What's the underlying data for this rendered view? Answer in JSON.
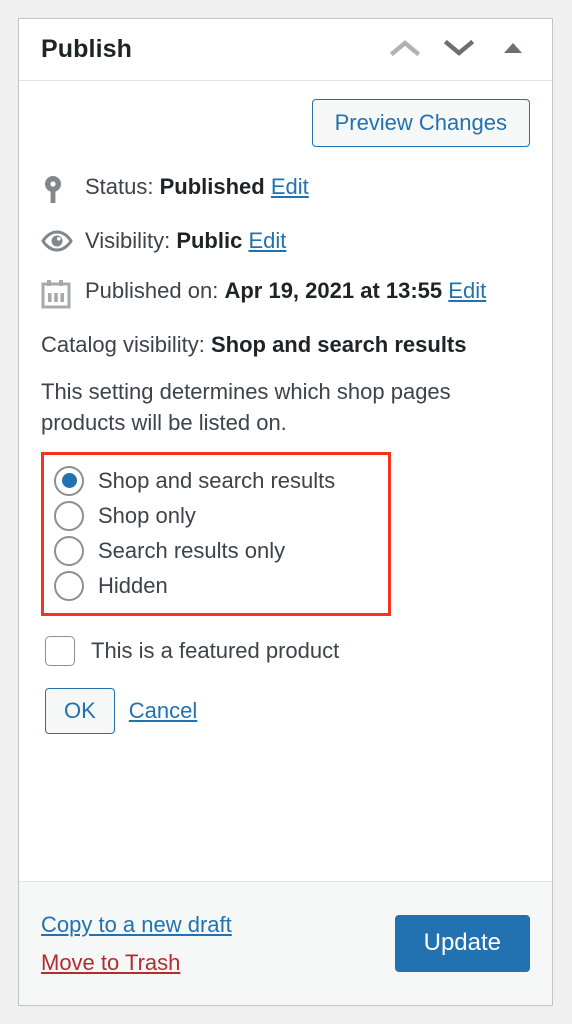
{
  "panel": {
    "title": "Publish",
    "header_icons": [
      {
        "name": "chevron-up-icon",
        "glyph": "chevron-up"
      },
      {
        "name": "chevron-down-icon",
        "glyph": "chevron-down"
      },
      {
        "name": "toggle-panel-icon",
        "glyph": "triangle-up"
      }
    ]
  },
  "preview": {
    "label": "Preview Changes"
  },
  "status": {
    "icon": "post-status-pin-icon",
    "prefix": "Status:",
    "value": "Published",
    "edit_label": "Edit"
  },
  "visibility": {
    "icon": "visibility-eye-icon",
    "prefix": "Visibility:",
    "value": "Public",
    "edit_label": "Edit"
  },
  "published": {
    "icon": "calendar-icon",
    "prefix": "Published on:",
    "value": "Apr 19, 2021 at 13:55",
    "edit_label": "Edit"
  },
  "catalog": {
    "prefix": "Catalog visibility:",
    "value": "Shop and search results",
    "help_text": "This setting determines which shop pages products will be listed on.",
    "options": [
      {
        "label": "Shop and search results",
        "selected": true
      },
      {
        "label": "Shop only",
        "selected": false
      },
      {
        "label": "Search results only",
        "selected": false
      },
      {
        "label": "Hidden",
        "selected": false
      }
    ],
    "featured_label": "This is a featured product",
    "featured_checked": false,
    "ok_label": "OK",
    "cancel_label": "Cancel",
    "highlight_color": "#f5341f"
  },
  "footer": {
    "copy_draft_label": "Copy to a new draft",
    "trash_label": "Move to Trash",
    "update_label": "Update"
  },
  "colors": {
    "accent": "#2271b1",
    "danger": "#b32d2e",
    "icon_grey": "#82878c",
    "panel_border": "#c3c4c7",
    "footer_bg": "#f6f7f7"
  }
}
